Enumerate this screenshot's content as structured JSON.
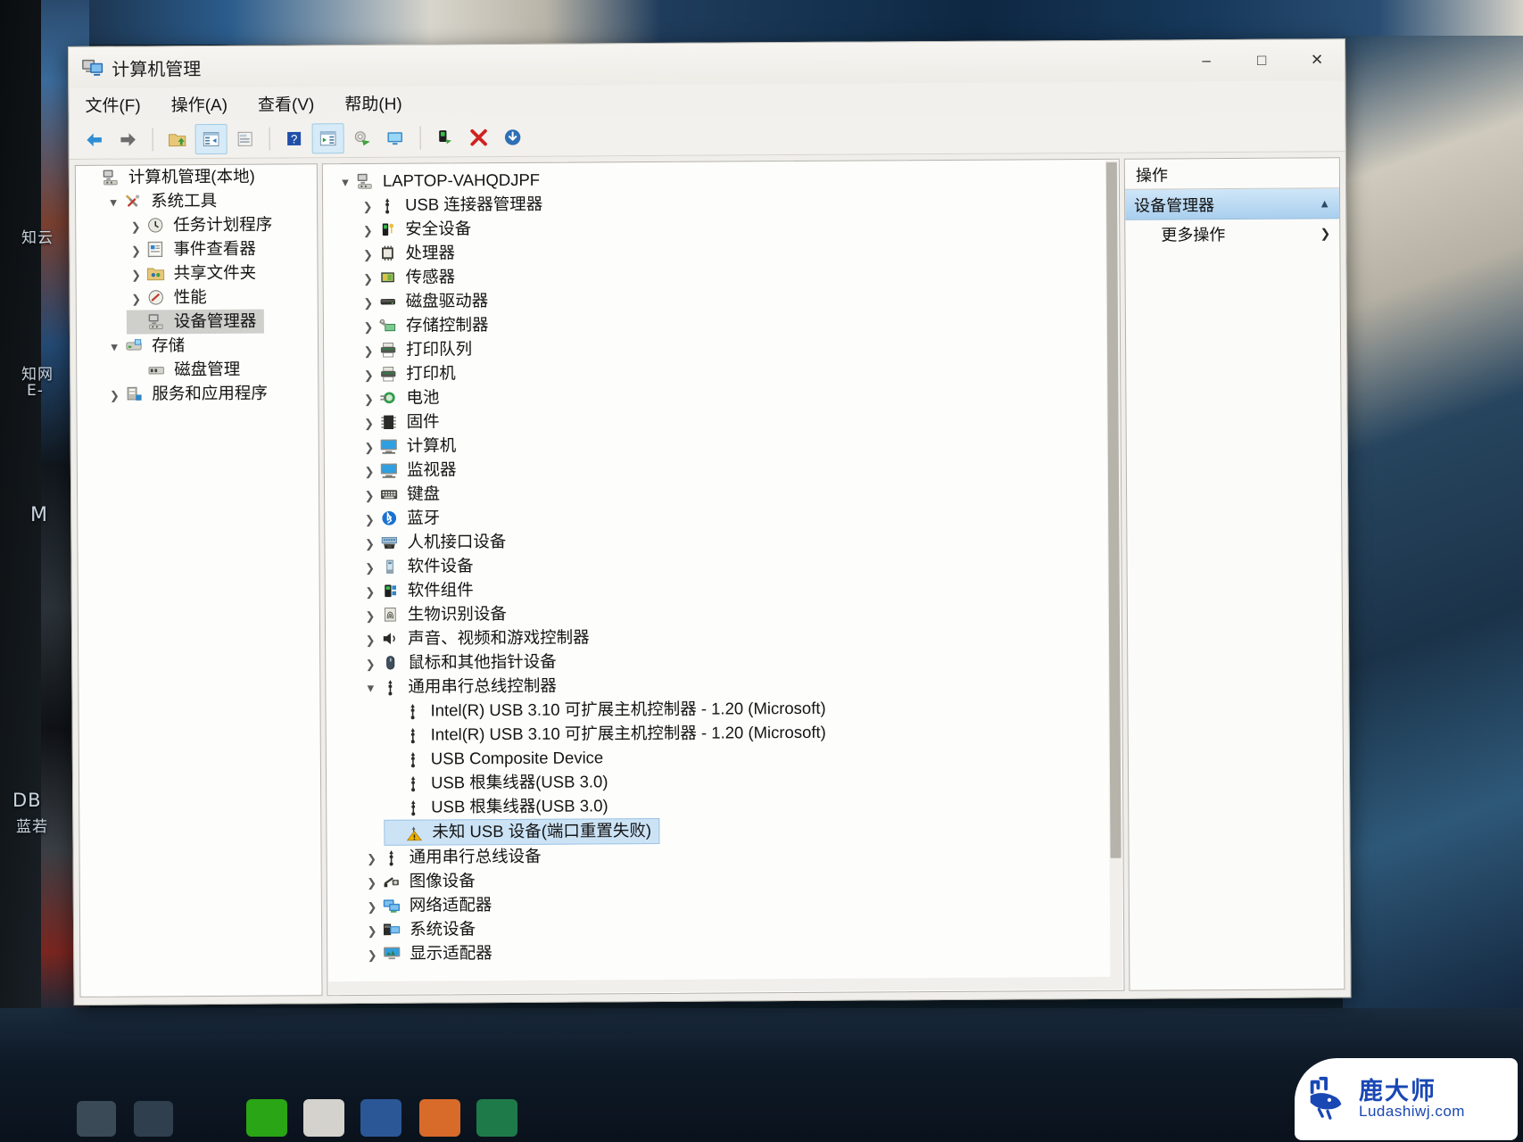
{
  "window": {
    "title": "计算机管理",
    "icon": "computer-management-icon",
    "controls": {
      "minimize": "–",
      "maximize": "□",
      "close": "✕"
    }
  },
  "menu": [
    {
      "label": "文件(F)"
    },
    {
      "label": "操作(A)"
    },
    {
      "label": "查看(V)"
    },
    {
      "label": "帮助(H)"
    }
  ],
  "toolbar": [
    {
      "name": "back-icon",
      "group": 0
    },
    {
      "name": "forward-icon",
      "group": 0
    },
    {
      "name": "up-folder-icon",
      "group": 1
    },
    {
      "name": "show-hide-console-tree-icon",
      "group": 1,
      "active": true
    },
    {
      "name": "properties-icon",
      "group": 1
    },
    {
      "name": "help-icon",
      "group": 2
    },
    {
      "name": "show-hide-action-pane-icon",
      "group": 2,
      "active": true
    },
    {
      "name": "scan-hardware-changes-icon",
      "group": 2
    },
    {
      "name": "update-driver-icon",
      "group": 2
    },
    {
      "name": "enable-device-icon",
      "group": 3
    },
    {
      "name": "uninstall-device-icon",
      "group": 3
    },
    {
      "name": "download-icon",
      "group": 4
    }
  ],
  "sidebar": {
    "items": [
      {
        "label": "计算机管理(本地)",
        "indent": 0,
        "chevron": "none",
        "icon": "computer-management-icon",
        "selected": false
      },
      {
        "label": "系统工具",
        "indent": 1,
        "chevron": "open",
        "icon": "system-tools-icon",
        "selected": false
      },
      {
        "label": "任务计划程序",
        "indent": 2,
        "chevron": "closed",
        "icon": "task-scheduler-icon",
        "selected": false
      },
      {
        "label": "事件查看器",
        "indent": 2,
        "chevron": "closed",
        "icon": "event-viewer-icon",
        "selected": false
      },
      {
        "label": "共享文件夹",
        "indent": 2,
        "chevron": "closed",
        "icon": "shared-folders-icon",
        "selected": false
      },
      {
        "label": "性能",
        "indent": 2,
        "chevron": "closed",
        "icon": "performance-icon",
        "selected": false
      },
      {
        "label": "设备管理器",
        "indent": 2,
        "chevron": "none",
        "icon": "device-manager-icon",
        "selected": true
      },
      {
        "label": "存储",
        "indent": 1,
        "chevron": "open",
        "icon": "storage-icon",
        "selected": false
      },
      {
        "label": "磁盘管理",
        "indent": 2,
        "chevron": "none",
        "icon": "disk-management-icon",
        "selected": false
      },
      {
        "label": "服务和应用程序",
        "indent": 1,
        "chevron": "closed",
        "icon": "services-and-apps-icon",
        "selected": false
      }
    ]
  },
  "device_tree": {
    "root": "LAPTOP-VAHQDJPF",
    "items": [
      {
        "label": "LAPTOP-VAHQDJPF",
        "indent": 0,
        "chevron": "open",
        "icon": "computer-node-icon",
        "selected": false
      },
      {
        "label": "USB 连接器管理器",
        "indent": 1,
        "chevron": "closed",
        "icon": "usb-icon",
        "selected": false
      },
      {
        "label": "安全设备",
        "indent": 1,
        "chevron": "closed",
        "icon": "security-device-icon",
        "selected": false
      },
      {
        "label": "处理器",
        "indent": 1,
        "chevron": "closed",
        "icon": "processor-icon",
        "selected": false
      },
      {
        "label": "传感器",
        "indent": 1,
        "chevron": "closed",
        "icon": "sensor-icon",
        "selected": false
      },
      {
        "label": "磁盘驱动器",
        "indent": 1,
        "chevron": "closed",
        "icon": "disk-drive-icon",
        "selected": false
      },
      {
        "label": "存储控制器",
        "indent": 1,
        "chevron": "closed",
        "icon": "storage-controller-icon",
        "selected": false
      },
      {
        "label": "打印队列",
        "indent": 1,
        "chevron": "closed",
        "icon": "print-queue-icon",
        "selected": false
      },
      {
        "label": "打印机",
        "indent": 1,
        "chevron": "closed",
        "icon": "printer-icon",
        "selected": false
      },
      {
        "label": "电池",
        "indent": 1,
        "chevron": "closed",
        "icon": "battery-icon",
        "selected": false
      },
      {
        "label": "固件",
        "indent": 1,
        "chevron": "closed",
        "icon": "firmware-icon",
        "selected": false
      },
      {
        "label": "计算机",
        "indent": 1,
        "chevron": "closed",
        "icon": "computer-icon",
        "selected": false
      },
      {
        "label": "监视器",
        "indent": 1,
        "chevron": "closed",
        "icon": "monitor-icon",
        "selected": false
      },
      {
        "label": "键盘",
        "indent": 1,
        "chevron": "closed",
        "icon": "keyboard-icon",
        "selected": false
      },
      {
        "label": "蓝牙",
        "indent": 1,
        "chevron": "closed",
        "icon": "bluetooth-icon",
        "selected": false
      },
      {
        "label": "人机接口设备",
        "indent": 1,
        "chevron": "closed",
        "icon": "hid-icon",
        "selected": false
      },
      {
        "label": "软件设备",
        "indent": 1,
        "chevron": "closed",
        "icon": "software-device-icon",
        "selected": false
      },
      {
        "label": "软件组件",
        "indent": 1,
        "chevron": "closed",
        "icon": "software-component-icon",
        "selected": false
      },
      {
        "label": "生物识别设备",
        "indent": 1,
        "chevron": "closed",
        "icon": "biometric-icon",
        "selected": false
      },
      {
        "label": "声音、视频和游戏控制器",
        "indent": 1,
        "chevron": "closed",
        "icon": "sound-icon",
        "selected": false
      },
      {
        "label": "鼠标和其他指针设备",
        "indent": 1,
        "chevron": "closed",
        "icon": "mouse-icon",
        "selected": false
      },
      {
        "label": "通用串行总线控制器",
        "indent": 1,
        "chevron": "open",
        "icon": "usb-icon",
        "selected": false
      },
      {
        "label": "Intel(R) USB 3.10 可扩展主机控制器 - 1.20 (Microsoft)",
        "indent": 2,
        "chevron": "none",
        "icon": "usb-icon",
        "selected": false
      },
      {
        "label": "Intel(R) USB 3.10 可扩展主机控制器 - 1.20 (Microsoft)",
        "indent": 2,
        "chevron": "none",
        "icon": "usb-icon",
        "selected": false
      },
      {
        "label": "USB Composite Device",
        "indent": 2,
        "chevron": "none",
        "icon": "usb-icon",
        "selected": false
      },
      {
        "label": "USB 根集线器(USB 3.0)",
        "indent": 2,
        "chevron": "none",
        "icon": "usb-icon",
        "selected": false
      },
      {
        "label": "USB 根集线器(USB 3.0)",
        "indent": 2,
        "chevron": "none",
        "icon": "usb-icon",
        "selected": false
      },
      {
        "label": "未知 USB 设备(端口重置失败)",
        "indent": 2,
        "chevron": "none",
        "icon": "usb-warning-icon",
        "selected": true
      },
      {
        "label": "通用串行总线设备",
        "indent": 1,
        "chevron": "closed",
        "icon": "usb-icon",
        "selected": false
      },
      {
        "label": "图像设备",
        "indent": 1,
        "chevron": "closed",
        "icon": "imaging-device-icon",
        "selected": false
      },
      {
        "label": "网络适配器",
        "indent": 1,
        "chevron": "closed",
        "icon": "network-adapter-icon",
        "selected": false
      },
      {
        "label": "系统设备",
        "indent": 1,
        "chevron": "closed",
        "icon": "system-device-icon",
        "selected": false
      },
      {
        "label": "显示适配器",
        "indent": 1,
        "chevron": "closed",
        "icon": "display-adapter-icon",
        "selected": false
      }
    ]
  },
  "actions_pane": {
    "header": "操作",
    "selected_item": "设备管理器",
    "more_actions": "更多操作"
  },
  "desktop": {
    "labels": [
      "知云",
      "知网",
      "E-",
      "M",
      "DB",
      "蓝若"
    ]
  },
  "watermark": {
    "cn": "鹿大师",
    "en": "Ludashiwj.com"
  },
  "colors": {
    "selection_blue": "#cce3f6",
    "selection_gray": "#cfcfcb",
    "action_highlight": "#a9cfee",
    "warning_yellow": "#f0b400",
    "window_bg": "#f0efeb",
    "watermark_blue": "#1947b4"
  }
}
